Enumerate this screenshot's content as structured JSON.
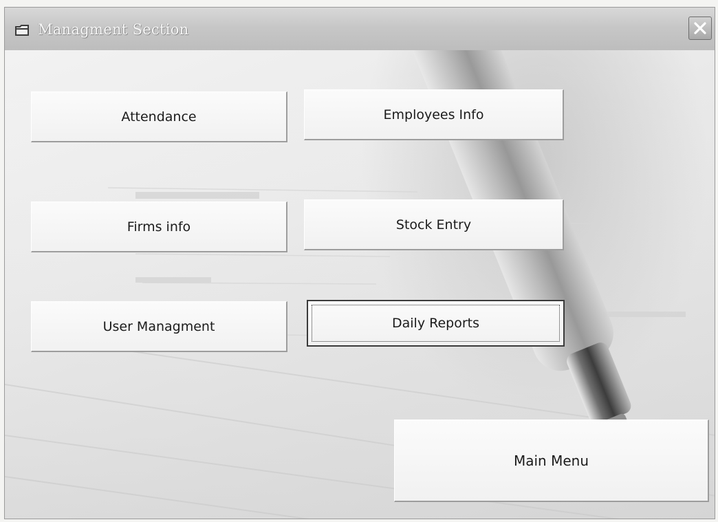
{
  "window": {
    "title": "Managment Section"
  },
  "buttons": {
    "attendance": "Attendance",
    "employees_info": "Employees Info",
    "firms_info": "Firms info",
    "stock_entry": "Stock Entry",
    "user_managment": "User Managment",
    "daily_reports": "Daily Reports",
    "main_menu": "Main Menu"
  },
  "focused_button": "daily_reports",
  "icons": {
    "title": "window-icon",
    "close": "close-icon",
    "background": "pen-on-paper-image"
  },
  "colors": {
    "window_bg": "#ececec",
    "titlebar": "#c7c7c7",
    "button_face": "#f6f6f6",
    "button_shadow": "#9d9d9d"
  }
}
